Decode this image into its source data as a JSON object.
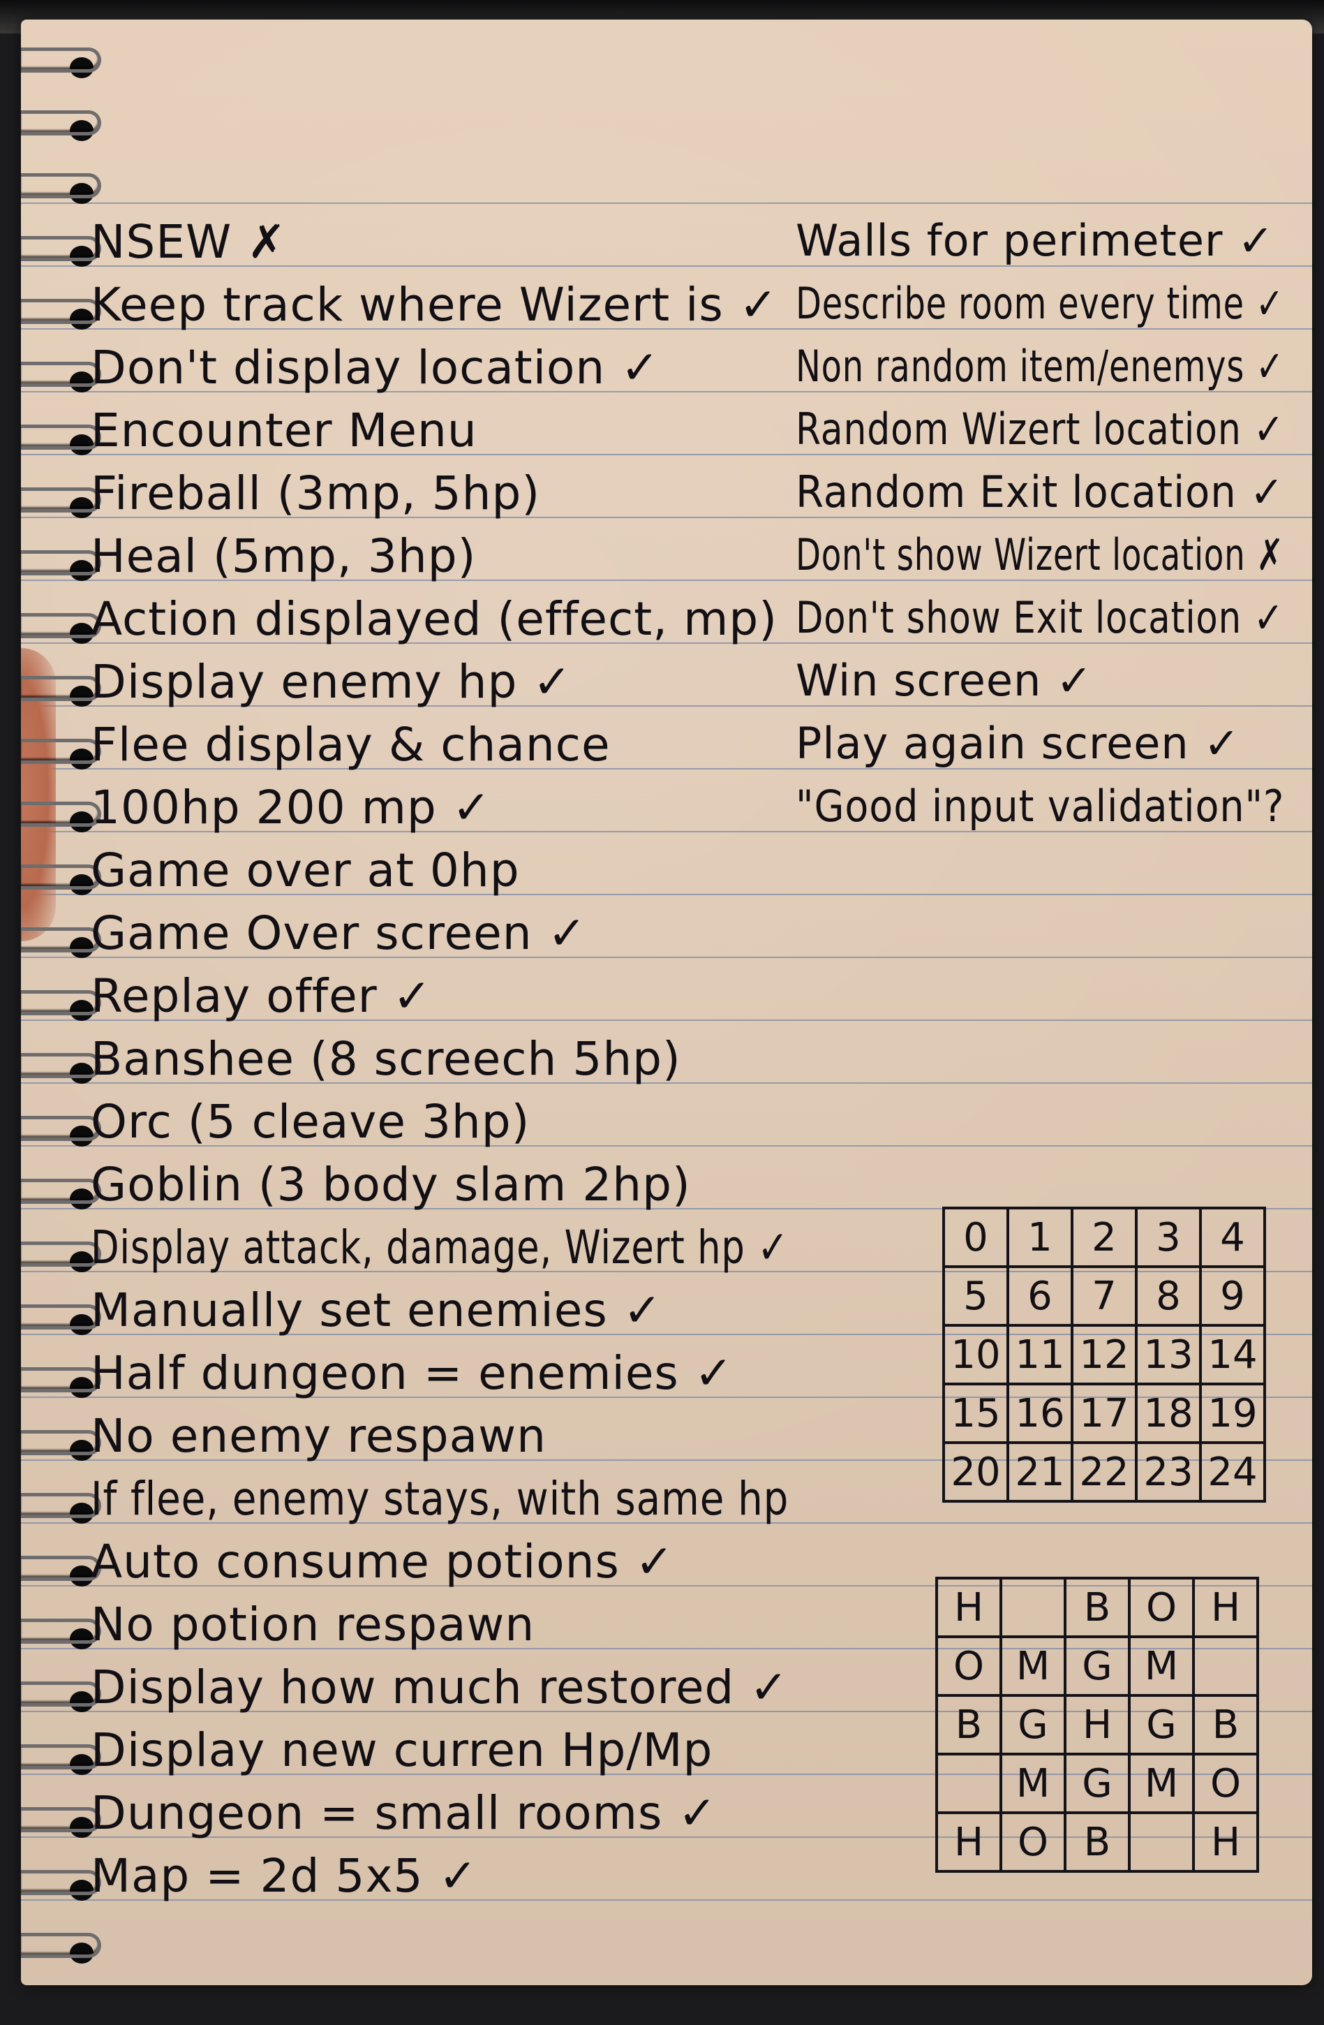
{
  "left_list": [
    "NSEW ✗",
    "Keep track where Wizert is ✓",
    "Don't display location ✓",
    "Encounter Menu",
    "Fireball (3mp, 5hp)",
    "Heal (5mp, 3hp)",
    "Action displayed (effect, mp)",
    "Display enemy hp ✓",
    "Flee display & chance",
    "100hp 200 mp ✓",
    "Game over at 0hp",
    "Game Over screen ✓",
    "Replay offer ✓",
    "Banshee (8 screech 5hp)",
    "Orc (5 cleave 3hp)",
    "Goblin (3 body slam 2hp)",
    "Display attack, damage, Wizert hp ✓",
    "Manually set enemies ✓",
    "Half dungeon = enemies ✓",
    "No enemy respawn",
    "If flee, enemy stays, with same hp",
    "Auto consume potions ✓",
    "No potion respawn",
    "Display how much restored ✓",
    "Display new curren Hp/Mp",
    "Dungeon = small rooms ✓",
    "Map = 2d 5x5 ✓"
  ],
  "right_list": [
    "Walls for perimeter ✓",
    "Describe room every time ✓",
    "Non random item/enemys ✓",
    "Random Wizert location ✓",
    "Random Exit location ✓",
    "Don't show Wizert location ✗",
    "Don't show Exit location ✓",
    "Win screen ✓",
    "Play again screen ✓",
    "\"Good input validation\"?"
  ],
  "number_grid": [
    [
      "0",
      "1",
      "2",
      "3",
      "4"
    ],
    [
      "5",
      "6",
      "7",
      "8",
      "9"
    ],
    [
      "10",
      "11",
      "12",
      "13",
      "14"
    ],
    [
      "15",
      "16",
      "17",
      "18",
      "19"
    ],
    [
      "20",
      "21",
      "22",
      "23",
      "24"
    ]
  ],
  "map_grid": [
    [
      "H",
      "",
      "B",
      "O",
      "H"
    ],
    [
      "O",
      "M",
      "G",
      "M",
      ""
    ],
    [
      "B",
      "G",
      "H",
      "G",
      "B"
    ],
    [
      "",
      "M",
      "G",
      "M",
      "O"
    ],
    [
      "H",
      "O",
      "B",
      "",
      "H"
    ]
  ],
  "colors": {
    "paper": "#e4cdb6",
    "ink": "#121014",
    "rule_line": "#7c8aa4",
    "orange_cover": "#e08a3e"
  }
}
